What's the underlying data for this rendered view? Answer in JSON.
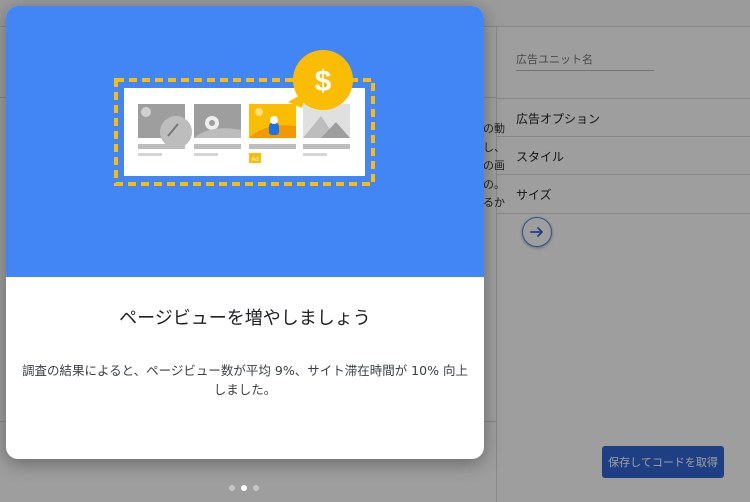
{
  "background": {
    "snippet_lines": [
      "の動",
      "し、",
      "の画",
      "の。",
      "るか"
    ]
  },
  "panel": {
    "ad_unit_name_label": "広告ユニット名",
    "rows": [
      {
        "label": "広告オプション"
      },
      {
        "label": "スタイル"
      },
      {
        "label": "サイズ"
      }
    ],
    "next_icon": "arrow-right-icon",
    "save_button_label": "保存してコードを取得"
  },
  "modal": {
    "title": "ページビューを増やしましょう",
    "description": "調査の結果によると、ページビュー数が平均 9%、サイト滞在時間が 10% 向上しました。",
    "illustration": {
      "coin_symbol": "$",
      "ad_badge": "Ad"
    },
    "pagination": {
      "total": 3,
      "active_index": 1
    }
  },
  "colors": {
    "hero_blue": "#4285f4",
    "accent_yellow": "#fbbc04",
    "button_blue": "#3367d6"
  }
}
